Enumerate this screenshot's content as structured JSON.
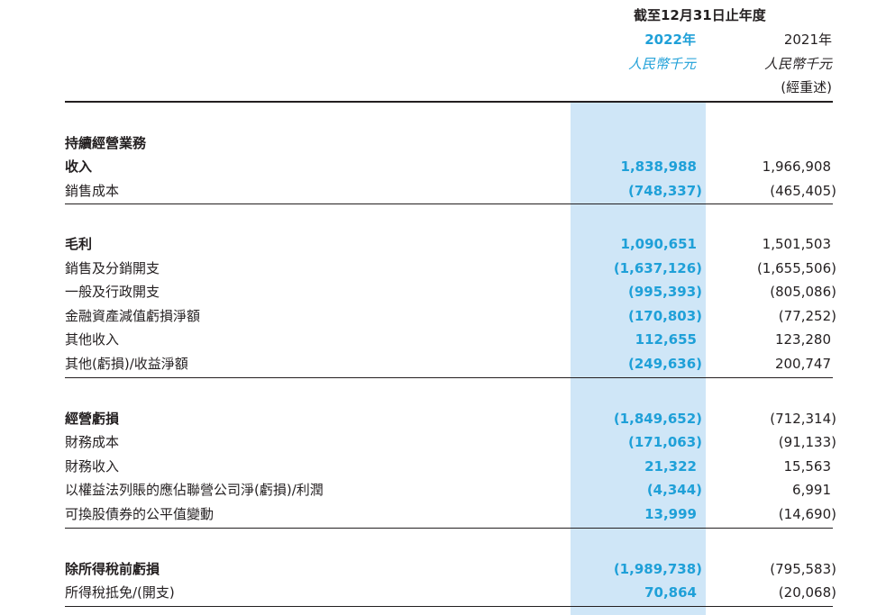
{
  "header": {
    "period": "截至12月31日止年度",
    "col_2022_year": "2022年",
    "col_2022_unit": "人民幣千元",
    "col_2021_year": "2021年",
    "col_2021_unit": "人民幣千元",
    "col_2021_note": "(經重述)"
  },
  "rows": [
    {
      "label": "持續經營業務",
      "v2022": "",
      "v2021": ""
    },
    {
      "label": "收入",
      "v2022": "1,838,988",
      "v2021": "1,966,908"
    },
    {
      "label": "銷售成本",
      "v2022": "(748,337)",
      "v2021": "(465,405)"
    },
    {
      "label": "毛利",
      "v2022": "1,090,651",
      "v2021": "1,501,503"
    },
    {
      "label": "銷售及分銷開支",
      "v2022": "(1,637,126)",
      "v2021": "(1,655,506)"
    },
    {
      "label": "一般及行政開支",
      "v2022": "(995,393)",
      "v2021": "(805,086)"
    },
    {
      "label": "金融資產減值虧損淨額",
      "v2022": "(170,803)",
      "v2021": "(77,252)"
    },
    {
      "label": "其他收入",
      "v2022": "112,655",
      "v2021": "123,280"
    },
    {
      "label": "其他(虧損)/收益淨額",
      "v2022": "(249,636)",
      "v2021": "200,747"
    },
    {
      "label": "經營虧損",
      "v2022": "(1,849,652)",
      "v2021": "(712,314)"
    },
    {
      "label": "財務成本",
      "v2022": "(171,063)",
      "v2021": "(91,133)"
    },
    {
      "label": "財務收入",
      "v2022": "21,322",
      "v2021": "15,563"
    },
    {
      "label": "以權益法列賬的應佔聯營公司淨(虧損)/利潤",
      "v2022": "(4,344)",
      "v2021": "6,991"
    },
    {
      "label": "可換股債券的公平值變動",
      "v2022": "13,999",
      "v2021": "(14,690)"
    },
    {
      "label": "除所得稅前虧損",
      "v2022": "(1,989,738)",
      "v2021": "(795,583)"
    },
    {
      "label": "所得稅抵免/(開支)",
      "v2022": "70,864",
      "v2021": "(20,068)"
    }
  ]
}
